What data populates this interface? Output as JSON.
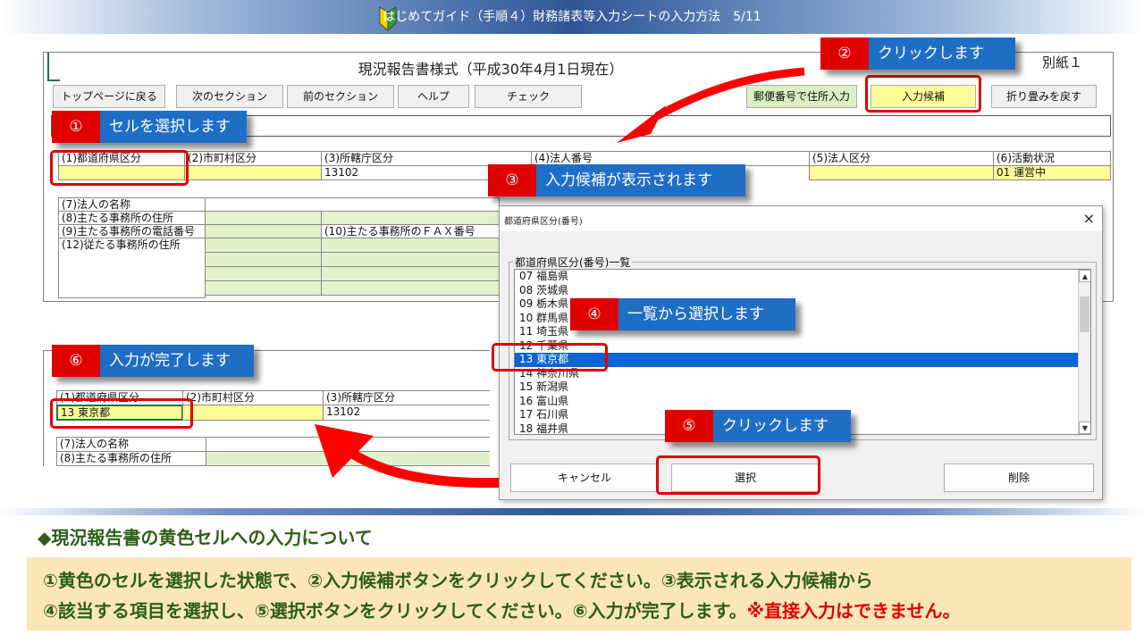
{
  "header": {
    "title": "はじめてガイド（手順４）財務諸表等入力シートの入力方法　5/11"
  },
  "sheet": {
    "title": "現況報告書様式（平成30年4月1日現在）",
    "attachment": "別紙１",
    "buttons": [
      "トップページに戻る",
      "次のセクション",
      "前のセクション",
      "ヘルプ",
      "チェック"
    ],
    "right_buttons": [
      "郵便番号で住所入力",
      "入力候補",
      "折り畳みを戻す"
    ],
    "headers": {
      "h1": "(1)都道府県区分",
      "h2": "(2)市町村区分",
      "h3": "(3)所轄庁区分",
      "h4": "(4)法人番号",
      "h5": "(5)法人区分",
      "h6": "(6)活動状況"
    },
    "values": {
      "v3": "13102",
      "v6": "01 運営中"
    },
    "labels": {
      "l7": "(7)法人の名称",
      "l8": "(8)主たる事務所の住所",
      "l9": "(9)主たる事務所の電話番号",
      "l10": "(10)主たる事務所のＦＡＸ番号",
      "l12": "(12)従たる事務所の住所"
    }
  },
  "result": {
    "headers": {
      "h1": "(1)都道府県区分",
      "h2": "(2)市町村区分",
      "h3": "(3)所轄庁区分"
    },
    "values": {
      "v1": "13 東京都",
      "v3": "13102"
    },
    "labels": {
      "l7": "(7)法人の名称",
      "l8": "(8)主たる事務所の住所"
    }
  },
  "dialog": {
    "title": "都道府県区分(番号)",
    "close": "×",
    "group_label": "都道府県区分(番号)一覧",
    "items": [
      "07 福島県",
      "08 茨城県",
      "09 栃木県",
      "10 群馬県",
      "11 埼玉県",
      "12 千葉県",
      "13 東京都",
      "14 神奈川県",
      "15 新潟県",
      "16 富山県",
      "17 石川県",
      "18 福井県"
    ],
    "selected_index": 6,
    "buttons": {
      "cancel": "キャンセル",
      "select": "選択",
      "delete": "削除"
    }
  },
  "callouts": [
    {
      "num": "①",
      "text": "セルを選択します"
    },
    {
      "num": "②",
      "text": "クリックします"
    },
    {
      "num": "③",
      "text": "入力候補が表示されます"
    },
    {
      "num": "④",
      "text": "一覧から選択します"
    },
    {
      "num": "⑤",
      "text": "クリックします"
    },
    {
      "num": "⑥",
      "text": "入力が完了します"
    }
  ],
  "note": {
    "heading": "◆現況報告書の黄色セルへの入力について",
    "line1": "①黄色のセルを選択した状態で、②入力候補ボタンをクリックしてください。③表示される入力候補から",
    "line2": "④該当する項目を選択し、⑤選択ボタンをクリックしてください。⑥入力が完了します。",
    "warning": "※直接入力はできません。"
  },
  "colors": {
    "callout_blue": "#1f6ec5",
    "callout_red": "#e00000",
    "yellow_cell": "#ffff99",
    "green_cell": "#e2f3cc",
    "note_text": "#2d5f18"
  }
}
